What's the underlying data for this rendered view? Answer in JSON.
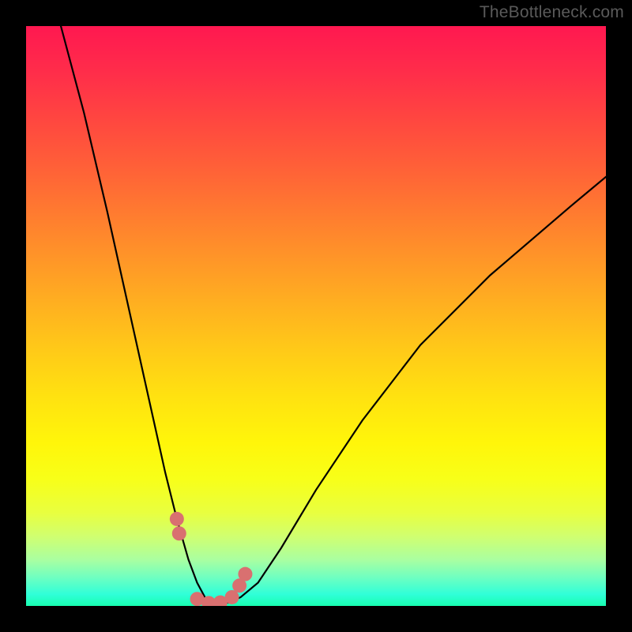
{
  "watermark": "TheBottleneck.com",
  "chart_data": {
    "type": "line",
    "title": "",
    "xlabel": "",
    "ylabel": "",
    "xlim": [
      0,
      100
    ],
    "ylim": [
      0,
      100
    ],
    "grid": false,
    "legend": false,
    "gradient_stops": [
      {
        "pos": 0,
        "color": "#ff1850"
      },
      {
        "pos": 50,
        "color": "#ffb020"
      },
      {
        "pos": 75,
        "color": "#fff60a"
      },
      {
        "pos": 100,
        "color": "#18ffb0"
      }
    ],
    "series": [
      {
        "name": "bottleneck-curve",
        "x": [
          6,
          10,
          14,
          18,
          22,
          24,
          26,
          28,
          29.5,
          31,
          33,
          35,
          37,
          40,
          44,
          50,
          58,
          68,
          80,
          94,
          100
        ],
        "y": [
          100,
          85,
          68,
          50,
          32,
          23,
          15,
          8,
          4,
          1.2,
          0.5,
          0.6,
          1.5,
          4,
          10,
          20,
          32,
          45,
          57,
          69,
          74
        ]
      }
    ],
    "markers": {
      "name": "highlighted-points",
      "color": "#d97070",
      "points": [
        {
          "x": 26.0,
          "y": 15.0
        },
        {
          "x": 26.4,
          "y": 12.5
        },
        {
          "x": 29.5,
          "y": 1.2
        },
        {
          "x": 31.5,
          "y": 0.5
        },
        {
          "x": 33.5,
          "y": 0.6
        },
        {
          "x": 35.5,
          "y": 1.5
        },
        {
          "x": 36.8,
          "y": 3.5
        },
        {
          "x": 37.8,
          "y": 5.5
        }
      ]
    }
  }
}
